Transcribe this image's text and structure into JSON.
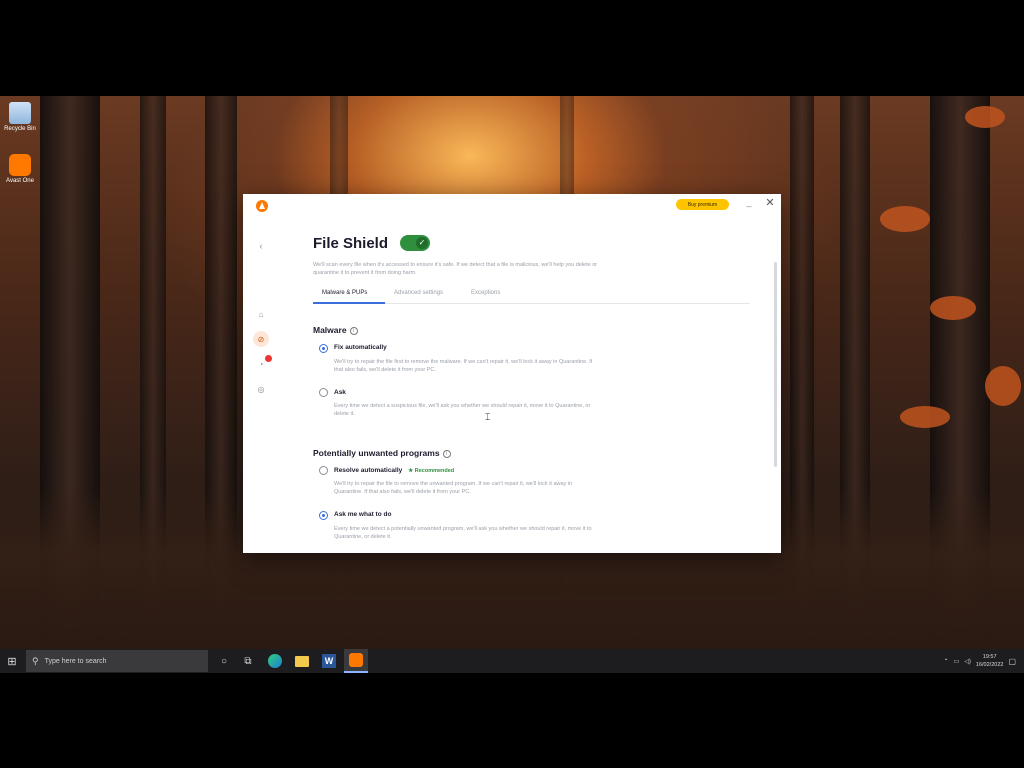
{
  "desktop": {
    "icons": [
      {
        "label": "Recycle Bin",
        "icon": "recycle-bin-icon"
      },
      {
        "label": "Avast One",
        "icon": "avast-icon"
      }
    ]
  },
  "app": {
    "buy_label": "Buy premium",
    "page_title": "File Shield",
    "toggle_on": true,
    "page_description": "We'll scan every file when it's accessed to ensure it's safe. If we detect that a file is malicious, we'll help you delete or quarantine it to prevent it from doing harm.",
    "tabs": [
      {
        "label": "Malware & PUPs",
        "active": true
      },
      {
        "label": "Advanced settings",
        "active": false
      },
      {
        "label": "Exceptions",
        "active": false
      }
    ],
    "malware": {
      "title": "Malware",
      "options": [
        {
          "label": "Fix automatically",
          "checked": true,
          "description": "We'll try to repair the file first to remove the malware. If we can't repair it, we'll lock it away in Quarantine. If that also fails, we'll delete it from your PC."
        },
        {
          "label": "Ask",
          "checked": false,
          "description": "Every time we detect a suspicious file, we'll ask you whether we should repair it, move it to Quarantine, or delete it."
        }
      ]
    },
    "pup": {
      "title": "Potentially unwanted programs",
      "options": [
        {
          "label": "Resolve automatically",
          "checked": false,
          "badge": "★ Recommended",
          "description": "We'll try to repair the file to remove the unwanted program. If we can't repair it, we'll lock it away in Quarantine. If that also fails, we'll delete it from your PC."
        },
        {
          "label": "Ask me what to do",
          "checked": true,
          "description": "Every time we detect a potentially unwanted program, we'll ask you whether we should repair it, move it to Quarantine, or delete it."
        }
      ]
    }
  },
  "taskbar": {
    "search_placeholder": "Type here to search",
    "time": "19:57",
    "date": "16/02/2022"
  }
}
